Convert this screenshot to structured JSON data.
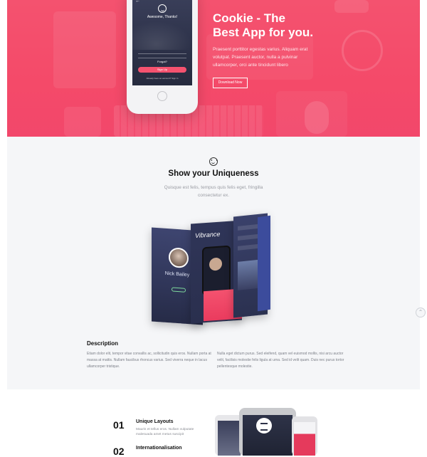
{
  "hero": {
    "title_line1": "Cookie - The",
    "title_line2": "Best App for you.",
    "text": "Praesent porttitor egestas varius. Aliquam erat volutpat. Praesent auctor, nulla a pulvinar ullamcorper, orci ante tincidunt libero",
    "button_label": "Download Now",
    "accent_color": "#f4526f",
    "phone": {
      "back_icon": "back-arrow-icon",
      "message": "Awesome, Thanks!",
      "forgot": "Forgot?",
      "signup_label": "Sign Up",
      "signin_line": "Already have an account? Sign In"
    }
  },
  "uniqueness": {
    "icon": "smile-icon",
    "title": "Show your Uniqueness",
    "subtitle": "Quisque est felis, tempus quis felis eget, fringilla consectetur ex.",
    "mockups": {
      "profile_name": "Nick Bailey",
      "app_name": "Vibrance"
    },
    "description_title": "Description",
    "description_left": "Etiam dolor elit, tempor vitae convallis ac, sollicitudin quis eros. Nullam porta at massa at mattis. Nullam faucibus rhoncus varius. Sed viverra neque in lacus ullamcorper tristique.",
    "description_right": "Nulla eget dictum purus. Sed eleifend, quam vel euismod mollis, nisi arcu auctor velit, facilisis molestie felis ligula at urna. Sed id velit quam. Duis nec purus tortor pellentesque molestie."
  },
  "features": [
    {
      "number": "01",
      "title": "Unique Layouts",
      "text": "Mauris et tellus eros. Nullam vulputate malesuada amet metus suscipit"
    },
    {
      "number": "02",
      "title": "Internationalisation",
      "text": ""
    }
  ]
}
